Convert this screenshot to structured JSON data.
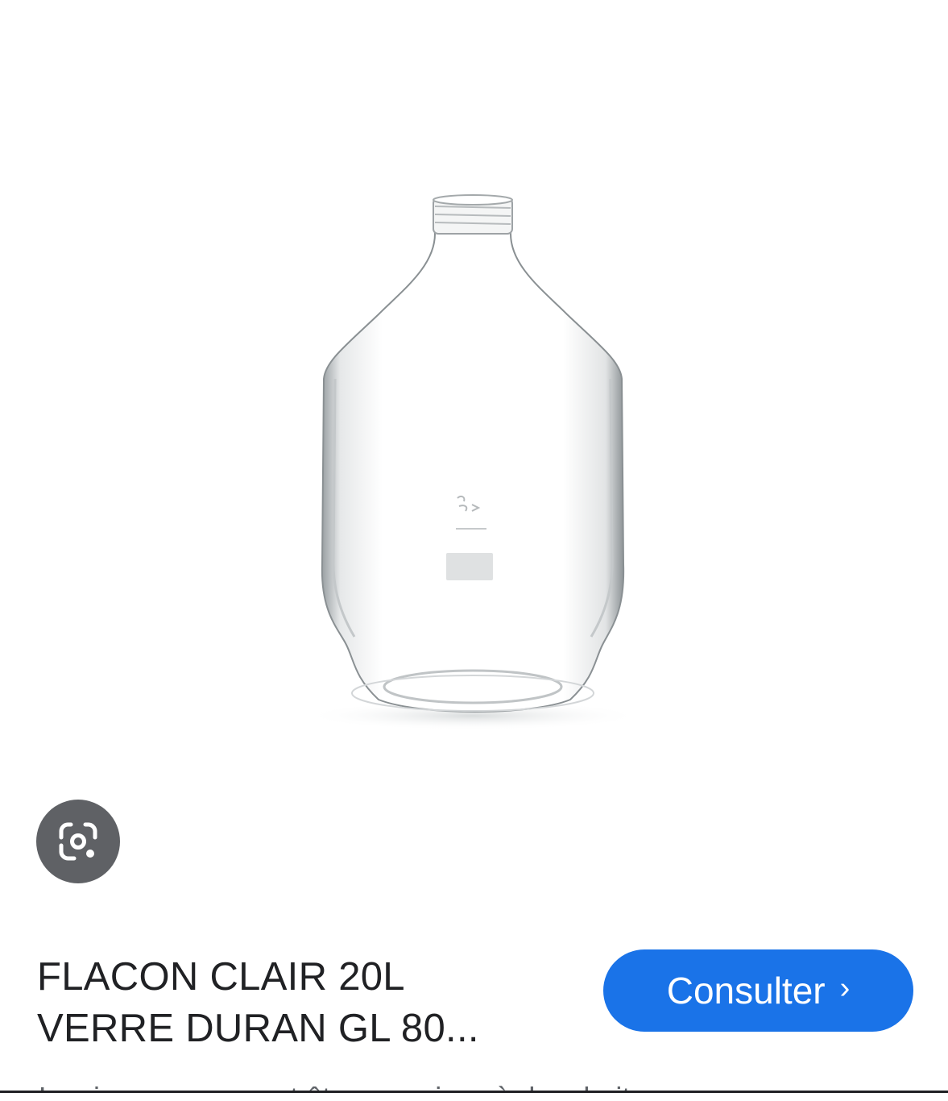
{
  "product": {
    "title_line1": "FLACON CLAIR 20L",
    "title_line2": "VERRE DURAN GL 80..."
  },
  "actions": {
    "visit_label": "Consulter",
    "visit_chevron": "›",
    "lens_icon": "google-lens-icon"
  },
  "footer": {
    "disclaimer": "Les images peuvent être soumises à des droits"
  },
  "colors": {
    "accent": "#1a73e8",
    "lens_bg": "#5f6165",
    "text": "#202124",
    "muted": "#5f6368"
  }
}
